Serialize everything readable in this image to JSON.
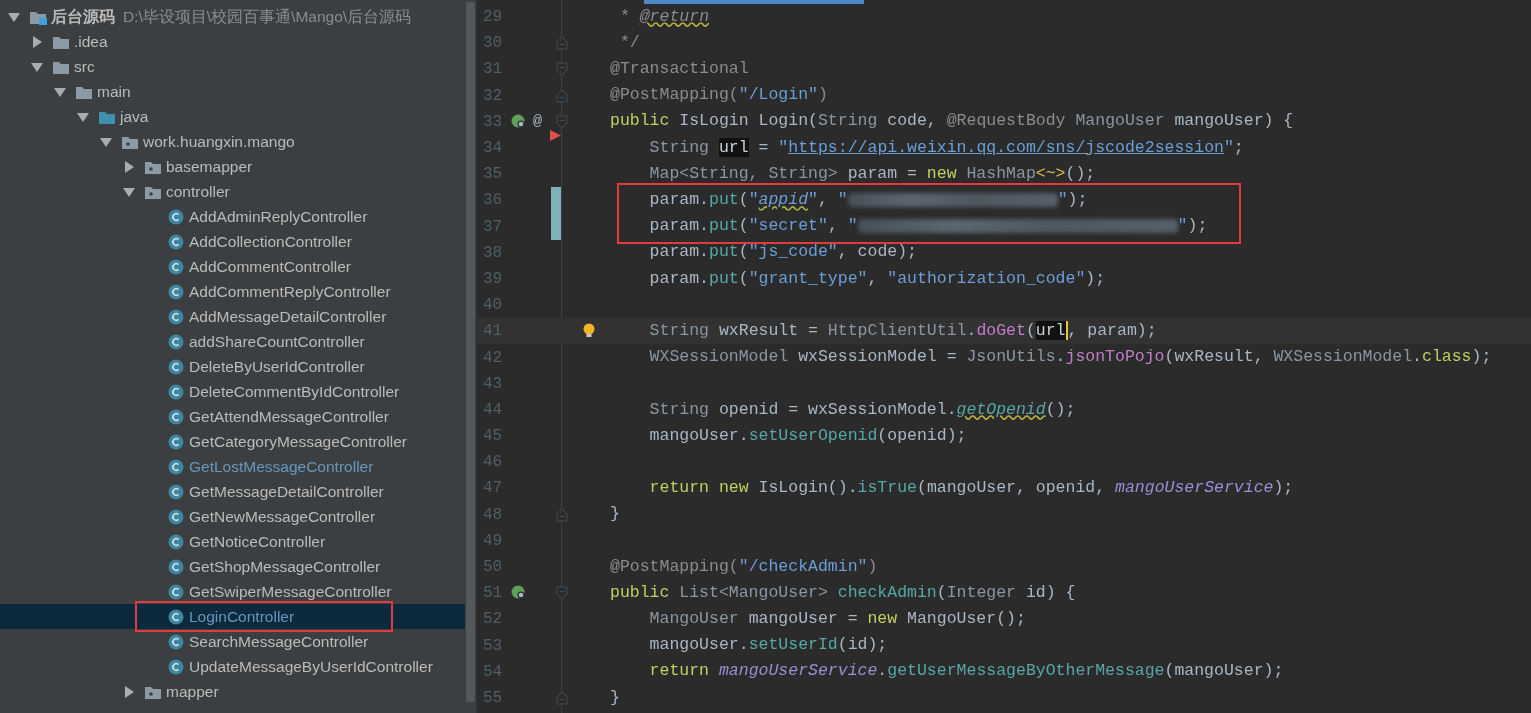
{
  "project_tree": {
    "items": [
      {
        "label": "后台源码",
        "path": "D:\\毕设项目\\校园百事通\\Mango\\后台源码",
        "kind": "project",
        "expanded": true,
        "selected": false,
        "children": [
          {
            "label": ".idea",
            "kind": "folder",
            "expanded": false,
            "selected": false
          },
          {
            "label": "src",
            "kind": "folder",
            "expanded": true,
            "selected": false,
            "children": [
              {
                "label": "main",
                "kind": "folder",
                "expanded": true,
                "selected": false,
                "children": [
                  {
                    "label": "java",
                    "kind": "source",
                    "expanded": true,
                    "selected": false,
                    "children": [
                      {
                        "label": "work.huangxin.mango",
                        "kind": "package",
                        "expanded": true,
                        "selected": false,
                        "children": [
                          {
                            "label": "basemapper",
                            "kind": "package",
                            "expanded": false,
                            "selected": false
                          },
                          {
                            "label": "controller",
                            "kind": "package",
                            "expanded": true,
                            "selected": false,
                            "children": [
                              {
                                "label": "AddAdminReplyController",
                                "kind": "class",
                                "selected": false,
                                "modified": false,
                                "boxed": false
                              },
                              {
                                "label": "AddCollectionController",
                                "kind": "class",
                                "selected": false,
                                "modified": false,
                                "boxed": false
                              },
                              {
                                "label": "AddCommentController",
                                "kind": "class",
                                "selected": false,
                                "modified": false,
                                "boxed": false
                              },
                              {
                                "label": "AddCommentReplyController",
                                "kind": "class",
                                "selected": false,
                                "modified": false,
                                "boxed": false
                              },
                              {
                                "label": "AddMessageDetailController",
                                "kind": "class",
                                "selected": false,
                                "modified": false,
                                "boxed": false
                              },
                              {
                                "label": "addShareCountController",
                                "kind": "class",
                                "selected": false,
                                "modified": false,
                                "boxed": false
                              },
                              {
                                "label": "DeleteByUserIdController",
                                "kind": "class",
                                "selected": false,
                                "modified": false,
                                "boxed": false
                              },
                              {
                                "label": "DeleteCommentByIdController",
                                "kind": "class",
                                "selected": false,
                                "modified": false,
                                "boxed": false
                              },
                              {
                                "label": "GetAttendMessageController",
                                "kind": "class",
                                "selected": false,
                                "modified": false,
                                "boxed": false
                              },
                              {
                                "label": "GetCategoryMessageController",
                                "kind": "class",
                                "selected": false,
                                "modified": false,
                                "boxed": false
                              },
                              {
                                "label": "GetLostMessageController",
                                "kind": "class",
                                "selected": false,
                                "modified": true,
                                "boxed": false
                              },
                              {
                                "label": "GetMessageDetailController",
                                "kind": "class",
                                "selected": false,
                                "modified": false,
                                "boxed": false
                              },
                              {
                                "label": "GetNewMessageController",
                                "kind": "class",
                                "selected": false,
                                "modified": false,
                                "boxed": false
                              },
                              {
                                "label": "GetNoticeController",
                                "kind": "class",
                                "selected": false,
                                "modified": false,
                                "boxed": false
                              },
                              {
                                "label": "GetShopMessageController",
                                "kind": "class",
                                "selected": false,
                                "modified": false,
                                "boxed": false
                              },
                              {
                                "label": "GetSwiperMessageController",
                                "kind": "class",
                                "selected": false,
                                "modified": false,
                                "boxed": false
                              },
                              {
                                "label": "LoginController",
                                "kind": "class",
                                "selected": true,
                                "modified": true,
                                "boxed": true
                              },
                              {
                                "label": "SearchMessageController",
                                "kind": "class",
                                "selected": false,
                                "modified": false,
                                "boxed": false
                              },
                              {
                                "label": "UpdateMessageByUserIdController",
                                "kind": "class",
                                "selected": false,
                                "modified": false,
                                "boxed": false
                              }
                            ]
                          },
                          {
                            "label": "mapper",
                            "kind": "package",
                            "expanded": false,
                            "selected": false
                          }
                        ]
                      }
                    ]
                  }
                ]
              }
            ]
          }
        ]
      }
    ]
  },
  "editor": {
    "lines": [
      {
        "number": "29",
        "tokens": [
          {
            "text": " * ",
            "kind": "comment"
          },
          {
            "text": "@return",
            "kind": "doctag"
          }
        ]
      },
      {
        "number": "30",
        "fold": {
          "kind": "end"
        },
        "tokens": [
          {
            "text": " */",
            "kind": "comment"
          }
        ]
      },
      {
        "number": "31",
        "fold": {
          "kind": "start"
        },
        "tokens": [
          {
            "text": "@Transactional",
            "kind": "ann"
          }
        ]
      },
      {
        "number": "32",
        "fold": {
          "kind": "end"
        },
        "tokens": [
          {
            "text": "@PostMapping(",
            "kind": "ann"
          },
          {
            "text": "\"/Login\"",
            "kind": "str"
          },
          {
            "text": ")",
            "kind": "ann"
          }
        ]
      },
      {
        "number": "33",
        "fold": {
          "kind": "start"
        },
        "gutter": [
          {
            "kind": "bean"
          },
          {
            "kind": "text",
            "text": "@"
          }
        ],
        "tokens": [
          {
            "text": "public ",
            "kind": "kw"
          },
          {
            "text": "IsLogin ",
            "kind": "cls"
          },
          {
            "text": "Login(",
            "kind": "plain"
          },
          {
            "text": "String ",
            "kind": "type"
          },
          {
            "text": "code, ",
            "kind": "plain"
          },
          {
            "text": "@RequestBody ",
            "kind": "ann"
          },
          {
            "text": "MangoUser ",
            "kind": "type"
          },
          {
            "text": "mangoUser) {",
            "kind": "plain"
          }
        ]
      },
      {
        "number": "34",
        "marker": {
          "kind": "arrow"
        },
        "tokens": [
          {
            "text": "    String ",
            "kind": "type"
          },
          {
            "text": "url",
            "kind": "hl"
          },
          {
            "text": " = ",
            "kind": "plain"
          },
          {
            "text": "\"",
            "kind": "str"
          },
          {
            "text": "https://api.weixin.qq.com/sns/jscode2session",
            "kind": "link"
          },
          {
            "text": "\"",
            "kind": "str"
          },
          {
            "text": ";",
            "kind": "plain"
          }
        ]
      },
      {
        "number": "35",
        "tokens": [
          {
            "text": "    Map<String, String> ",
            "kind": "type"
          },
          {
            "text": "param = ",
            "kind": "plain"
          },
          {
            "text": "new ",
            "kind": "kw"
          },
          {
            "text": "HashMap",
            "kind": "type"
          },
          {
            "text": "<~>",
            "kind": "diamond"
          },
          {
            "text": "();",
            "kind": "plain"
          }
        ]
      },
      {
        "number": "36",
        "changed": true,
        "boxed": true,
        "tokens": [
          {
            "text": "    param.",
            "kind": "plain"
          },
          {
            "text": "put",
            "kind": "meth"
          },
          {
            "text": "(",
            "kind": "plain"
          },
          {
            "text": "\"",
            "kind": "str"
          },
          {
            "text": "appid",
            "kind": "strlink"
          },
          {
            "text": "\"",
            "kind": "str"
          },
          {
            "text": ", ",
            "kind": "plain"
          },
          {
            "text": "\"",
            "kind": "str"
          },
          {
            "kind": "redacted-short"
          },
          {
            "text": "\"",
            "kind": "str"
          },
          {
            "text": ");",
            "kind": "plain"
          }
        ]
      },
      {
        "number": "37",
        "changed": true,
        "boxed": true,
        "tokens": [
          {
            "text": "    param.",
            "kind": "plain"
          },
          {
            "text": "put",
            "kind": "meth"
          },
          {
            "text": "(",
            "kind": "plain"
          },
          {
            "text": "\"secret\"",
            "kind": "str"
          },
          {
            "text": ", ",
            "kind": "plain"
          },
          {
            "text": "\"",
            "kind": "str"
          },
          {
            "kind": "redacted-long"
          },
          {
            "text": "\"",
            "kind": "str"
          },
          {
            "text": ");",
            "kind": "plain"
          }
        ]
      },
      {
        "number": "38",
        "tokens": [
          {
            "text": "    param.",
            "kind": "plain"
          },
          {
            "text": "put",
            "kind": "meth"
          },
          {
            "text": "(",
            "kind": "plain"
          },
          {
            "text": "\"js_code\"",
            "kind": "str"
          },
          {
            "text": ", code);",
            "kind": "plain"
          }
        ]
      },
      {
        "number": "39",
        "tokens": [
          {
            "text": "    param.",
            "kind": "plain"
          },
          {
            "text": "put",
            "kind": "meth"
          },
          {
            "text": "(",
            "kind": "plain"
          },
          {
            "text": "\"grant_type\"",
            "kind": "str"
          },
          {
            "text": ", ",
            "kind": "plain"
          },
          {
            "text": "\"authorization_code\"",
            "kind": "str"
          },
          {
            "text": ");",
            "kind": "plain"
          }
        ]
      },
      {
        "number": "40"
      },
      {
        "number": "41",
        "current": true,
        "gutter": [
          {
            "kind": "bulb"
          }
        ],
        "tokens": [
          {
            "text": "    String ",
            "kind": "type"
          },
          {
            "text": "wxResult = ",
            "kind": "plain"
          },
          {
            "text": "HttpClientUtil",
            "kind": "type"
          },
          {
            "text": ".",
            "kind": "plain"
          },
          {
            "text": "doGet",
            "kind": "static"
          },
          {
            "text": "(",
            "kind": "plain"
          },
          {
            "text": "url",
            "kind": "hl-caret"
          },
          {
            "text": ", param);",
            "kind": "plain"
          }
        ]
      },
      {
        "number": "42",
        "tokens": [
          {
            "text": "    WXSessionModel ",
            "kind": "type"
          },
          {
            "text": "wxSessionModel = ",
            "kind": "plain"
          },
          {
            "text": "JsonUtils",
            "kind": "type"
          },
          {
            "text": ".",
            "kind": "plain"
          },
          {
            "text": "jsonToPojo",
            "kind": "static"
          },
          {
            "text": "(wxResult, ",
            "kind": "plain"
          },
          {
            "text": "WXSessionModel",
            "kind": "type"
          },
          {
            "text": ".",
            "kind": "plain"
          },
          {
            "text": "class",
            "kind": "kw"
          },
          {
            "text": ");",
            "kind": "plain"
          }
        ]
      },
      {
        "number": "43"
      },
      {
        "number": "44",
        "tokens": [
          {
            "text": "    String ",
            "kind": "type"
          },
          {
            "text": "openid = wxSessionModel.",
            "kind": "plain"
          },
          {
            "text": "getOpenid",
            "kind": "methwarn"
          },
          {
            "text": "();",
            "kind": "plain"
          }
        ]
      },
      {
        "number": "45",
        "tokens": [
          {
            "text": "    mangoUser.",
            "kind": "plain"
          },
          {
            "text": "setUserOpenid",
            "kind": "meth"
          },
          {
            "text": "(openid);",
            "kind": "plain"
          }
        ]
      },
      {
        "number": "46"
      },
      {
        "number": "47",
        "tokens": [
          {
            "text": "    return new ",
            "kind": "kw"
          },
          {
            "text": "IsLogin",
            "kind": "cls"
          },
          {
            "text": "().",
            "kind": "plain"
          },
          {
            "text": "isTrue",
            "kind": "meth"
          },
          {
            "text": "(mangoUser, openid, ",
            "kind": "plain"
          },
          {
            "text": "mangoUserService",
            "kind": "field"
          },
          {
            "text": ");",
            "kind": "plain"
          }
        ]
      },
      {
        "number": "48",
        "fold": {
          "kind": "end"
        },
        "tokens": [
          {
            "text": "}",
            "kind": "plain"
          }
        ]
      },
      {
        "number": "49"
      },
      {
        "number": "50",
        "tokens": [
          {
            "text": "@PostMapping(",
            "kind": "ann"
          },
          {
            "text": "\"/checkAdmin\"",
            "kind": "str"
          },
          {
            "text": ")",
            "kind": "ann"
          }
        ]
      },
      {
        "number": "51",
        "fold": {
          "kind": "start"
        },
        "gutter": [
          {
            "kind": "bean"
          }
        ],
        "tokens": [
          {
            "text": "public ",
            "kind": "kw"
          },
          {
            "text": "List<MangoUser> ",
            "kind": "type"
          },
          {
            "text": "checkAdmin",
            "kind": "meth"
          },
          {
            "text": "(",
            "kind": "plain"
          },
          {
            "text": "Integer ",
            "kind": "type"
          },
          {
            "text": "id) {",
            "kind": "plain"
          }
        ]
      },
      {
        "number": "52",
        "tokens": [
          {
            "text": "    MangoUser ",
            "kind": "type"
          },
          {
            "text": "mangoUser = ",
            "kind": "plain"
          },
          {
            "text": "new ",
            "kind": "kw"
          },
          {
            "text": "MangoUser",
            "kind": "cls"
          },
          {
            "text": "();",
            "kind": "plain"
          }
        ]
      },
      {
        "number": "53",
        "tokens": [
          {
            "text": "    mangoUser.",
            "kind": "plain"
          },
          {
            "text": "setUserId",
            "kind": "meth"
          },
          {
            "text": "(id);",
            "kind": "plain"
          }
        ]
      },
      {
        "number": "54",
        "tokens": [
          {
            "text": "    return ",
            "kind": "kw"
          },
          {
            "text": "mangoUserService",
            "kind": "field"
          },
          {
            "text": ".",
            "kind": "plain"
          },
          {
            "text": "getUserMessageByOtherMessage",
            "kind": "meth"
          },
          {
            "text": "(mangoUser);",
            "kind": "plain"
          }
        ]
      },
      {
        "number": "55",
        "fold": {
          "kind": "end"
        },
        "tokens": [
          {
            "text": "}",
            "kind": "plain"
          }
        ]
      }
    ]
  }
}
